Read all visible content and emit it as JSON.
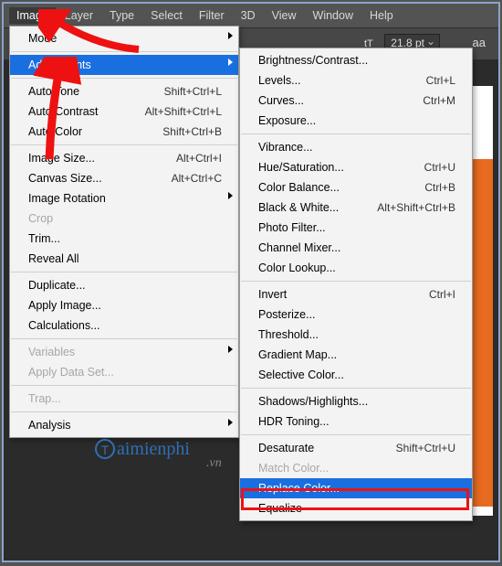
{
  "menubar": {
    "items": [
      "Image",
      "Layer",
      "Type",
      "Select",
      "Filter",
      "3D",
      "View",
      "Window",
      "Help"
    ]
  },
  "toolbar": {
    "pt_value": "21.8 pt",
    "aa": "aa"
  },
  "image_menu": [
    {
      "type": "row",
      "label": "Mode",
      "submenu": true
    },
    {
      "type": "sep"
    },
    {
      "type": "row",
      "label": "Adjustments",
      "submenu": true,
      "highlight": true
    },
    {
      "type": "sep"
    },
    {
      "type": "row",
      "label": "Auto Tone",
      "shortcut": "Shift+Ctrl+L"
    },
    {
      "type": "row",
      "label": "Auto Contrast",
      "shortcut": "Alt+Shift+Ctrl+L"
    },
    {
      "type": "row",
      "label": "Auto Color",
      "shortcut": "Shift+Ctrl+B"
    },
    {
      "type": "sep"
    },
    {
      "type": "row",
      "label": "Image Size...",
      "shortcut": "Alt+Ctrl+I"
    },
    {
      "type": "row",
      "label": "Canvas Size...",
      "shortcut": "Alt+Ctrl+C"
    },
    {
      "type": "row",
      "label": "Image Rotation",
      "submenu": true
    },
    {
      "type": "row",
      "label": "Crop",
      "disabled": true
    },
    {
      "type": "row",
      "label": "Trim..."
    },
    {
      "type": "row",
      "label": "Reveal All"
    },
    {
      "type": "sep"
    },
    {
      "type": "row",
      "label": "Duplicate..."
    },
    {
      "type": "row",
      "label": "Apply Image..."
    },
    {
      "type": "row",
      "label": "Calculations..."
    },
    {
      "type": "sep"
    },
    {
      "type": "row",
      "label": "Variables",
      "submenu": true,
      "disabled": true
    },
    {
      "type": "row",
      "label": "Apply Data Set...",
      "disabled": true
    },
    {
      "type": "sep"
    },
    {
      "type": "row",
      "label": "Trap...",
      "disabled": true
    },
    {
      "type": "sep"
    },
    {
      "type": "row",
      "label": "Analysis",
      "submenu": true
    }
  ],
  "adjust_menu": [
    {
      "type": "row",
      "label": "Brightness/Contrast..."
    },
    {
      "type": "row",
      "label": "Levels...",
      "shortcut": "Ctrl+L"
    },
    {
      "type": "row",
      "label": "Curves...",
      "shortcut": "Ctrl+M"
    },
    {
      "type": "row",
      "label": "Exposure..."
    },
    {
      "type": "sep"
    },
    {
      "type": "row",
      "label": "Vibrance..."
    },
    {
      "type": "row",
      "label": "Hue/Saturation...",
      "shortcut": "Ctrl+U"
    },
    {
      "type": "row",
      "label": "Color Balance...",
      "shortcut": "Ctrl+B"
    },
    {
      "type": "row",
      "label": "Black & White...",
      "shortcut": "Alt+Shift+Ctrl+B"
    },
    {
      "type": "row",
      "label": "Photo Filter..."
    },
    {
      "type": "row",
      "label": "Channel Mixer..."
    },
    {
      "type": "row",
      "label": "Color Lookup..."
    },
    {
      "type": "sep"
    },
    {
      "type": "row",
      "label": "Invert",
      "shortcut": "Ctrl+I"
    },
    {
      "type": "row",
      "label": "Posterize..."
    },
    {
      "type": "row",
      "label": "Threshold..."
    },
    {
      "type": "row",
      "label": "Gradient Map..."
    },
    {
      "type": "row",
      "label": "Selective Color..."
    },
    {
      "type": "sep"
    },
    {
      "type": "row",
      "label": "Shadows/Highlights..."
    },
    {
      "type": "row",
      "label": "HDR Toning..."
    },
    {
      "type": "sep"
    },
    {
      "type": "row",
      "label": "Desaturate",
      "shortcut": "Shift+Ctrl+U"
    },
    {
      "type": "row",
      "label": "Match Color...",
      "disabled": true
    },
    {
      "type": "row",
      "label": "Replace Color...",
      "highlight": true
    },
    {
      "type": "row",
      "label": "Equalize"
    }
  ],
  "watermark": {
    "text": "aimienphi",
    "sub": ".vn",
    "letter": "T"
  }
}
